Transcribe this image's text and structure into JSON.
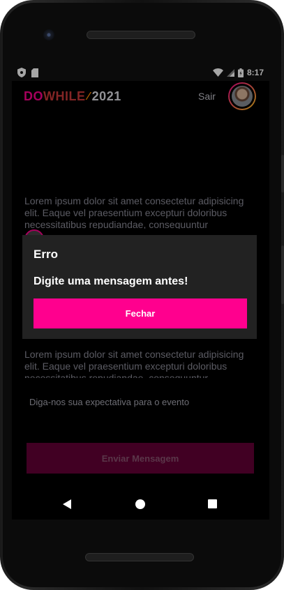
{
  "statusbar": {
    "time": "8:17"
  },
  "header": {
    "logo": {
      "do": "DO",
      "while": "WHILE",
      "slash": "⁄",
      "year": "2021"
    },
    "signout_label": "Sair"
  },
  "messages": [
    {
      "text": "Lorem ipsum dolor sit amet consectetur adipisicing elit. Eaque vel praesentium excepturi doloribus necessitatibus repudiandae, consequuntur"
    },
    {
      "text": "Lorem ipsum dolor sit amet consectetur adipisicing elit. Eaque vel praesentium excepturi doloribus necessitatibus repudiandae, consequuntur"
    }
  ],
  "composer": {
    "placeholder": "Diga-nos sua expectativa para o evento",
    "send_label": "Enviar Mensagem"
  },
  "dialog": {
    "title": "Erro",
    "message": "Digite uma mensagem antes!",
    "button_label": "Fechar"
  },
  "colors": {
    "accent": "#ff008e",
    "send_disabled": "#650037",
    "dialog_bg": "#222222"
  }
}
